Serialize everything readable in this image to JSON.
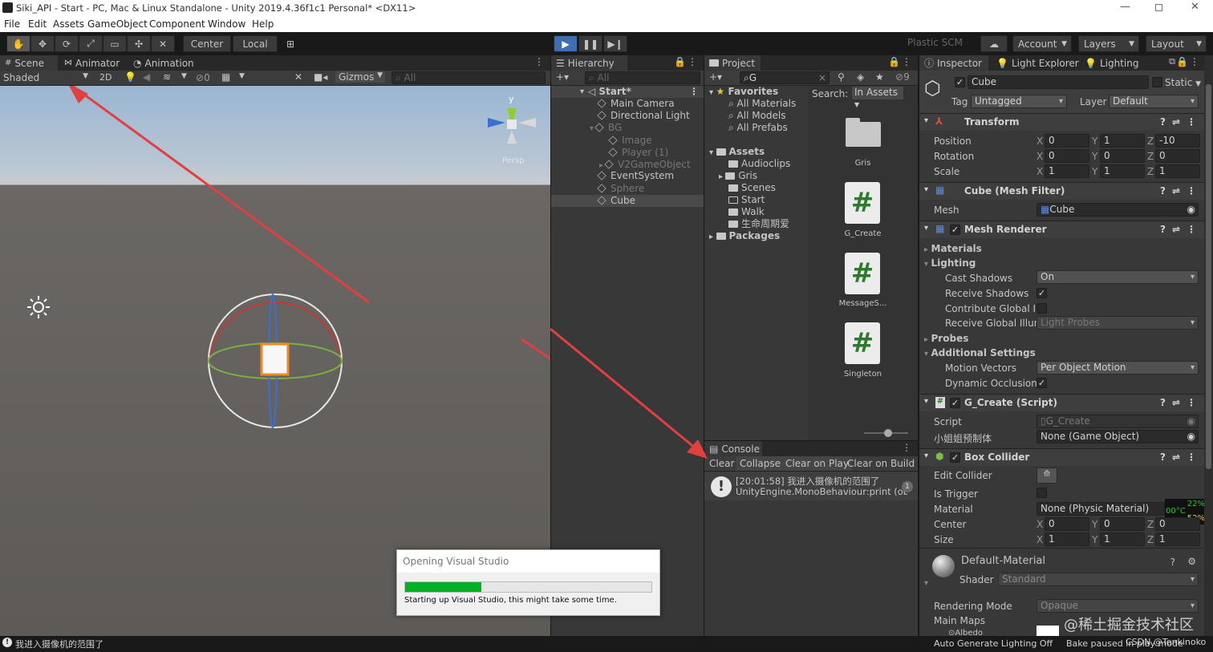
{
  "window": {
    "title": "Siki_API - Start - PC, Mac & Linux Standalone - Unity 2019.4.36f1c1 Personal* <DX11>"
  },
  "menu": [
    "File",
    "Edit",
    "Assets",
    "GameObject",
    "Component",
    "Window",
    "Help"
  ],
  "toolbar": {
    "center": "Center",
    "local": "Local",
    "plastic": "Plastic SCM",
    "account": "Account",
    "layers": "Layers",
    "layout": "Layout"
  },
  "scene": {
    "tabs": [
      "Scene",
      "Animator",
      "Animation"
    ],
    "shading": "Shaded",
    "mode2d": "2D",
    "fx_count": "0",
    "gizmos": "Gizmos",
    "search_placeholder": "All",
    "persp": "Persp",
    "axis_y": "y"
  },
  "hierarchy": {
    "title": "Hierarchy",
    "search_placeholder": "All",
    "scene_name": "Start*",
    "items": [
      {
        "label": "Main Camera",
        "dim": false
      },
      {
        "label": "Directional Light",
        "dim": false
      },
      {
        "label": "BG",
        "dim": true
      },
      {
        "label": "Image",
        "dim": true
      },
      {
        "label": "Player (1)",
        "dim": true
      },
      {
        "label": "V2GameObject",
        "dim": true
      },
      {
        "label": "EventSystem",
        "dim": false
      },
      {
        "label": "Sphere",
        "dim": true
      },
      {
        "label": "Cube",
        "dim": false
      }
    ]
  },
  "project": {
    "title": "Project",
    "search_value": "G",
    "hidden_count": "9",
    "search_label": "Search:",
    "search_scope": "In Assets",
    "favorites": "Favorites",
    "fav_items": [
      "All Materials",
      "All Models",
      "All Prefabs"
    ],
    "assets": "Assets",
    "asset_items": [
      "Audioclips",
      "Gris",
      "Scenes",
      "Start",
      "Walk",
      "生命周期爱"
    ],
    "packages": "Packages",
    "grid_items": [
      "Gris",
      "G_Create",
      "MessageS...",
      "Singleton"
    ]
  },
  "console": {
    "title": "Console",
    "buttons": [
      "Clear",
      "Collapse",
      "Clear on Play",
      "Clear on Build"
    ],
    "line1": "[20:01:58] 我进入摄像机的范围了",
    "line2": "UnityEngine.MonoBehaviour:print (object)",
    "count": "1"
  },
  "inspector": {
    "tabs": [
      "Inspector",
      "Light Explorer",
      "Lighting"
    ],
    "object_name": "Cube",
    "static_label": "Static",
    "tag_label": "Tag",
    "tag_value": "Untagged",
    "layer_label": "Layer",
    "layer_value": "Default",
    "transform": {
      "title": "Transform",
      "rows": [
        {
          "label": "Position",
          "x": "0",
          "y": "1",
          "z": "-10"
        },
        {
          "label": "Rotation",
          "x": "0",
          "y": "0",
          "z": "0"
        },
        {
          "label": "Scale",
          "x": "1",
          "y": "1",
          "z": "1"
        }
      ]
    },
    "mesh_filter": {
      "title": "Cube (Mesh Filter)",
      "mesh_label": "Mesh",
      "mesh_value": "Cube"
    },
    "mesh_renderer": {
      "title": "Mesh Renderer",
      "materials": "Materials",
      "lighting": "Lighting",
      "cast_shadows": "Cast Shadows",
      "cast_value": "On",
      "receive_shadows": "Receive Shadows",
      "contribute_gi": "Contribute Global Illu",
      "receive_gi": "Receive Global Illumi",
      "receive_gi_value": "Light Probes",
      "probes": "Probes",
      "additional": "Additional Settings",
      "motion_vectors": "Motion Vectors",
      "motion_value": "Per Object Motion",
      "dynamic_occlusion": "Dynamic Occlusion"
    },
    "script": {
      "title": "G_Create (Script)",
      "script_label": "Script",
      "script_value": "G_Create",
      "field_label": "小姐姐预制体",
      "field_value": "None (Game Object)"
    },
    "box_collider": {
      "title": "Box Collider",
      "edit": "Edit Collider",
      "trigger": "Is Trigger",
      "material": "Material",
      "material_value": "None (Physic Material)",
      "center": {
        "label": "Center",
        "x": "0",
        "y": "0",
        "z": "0"
      },
      "size": {
        "label": "Size",
        "x": "1",
        "y": "1",
        "z": "1"
      }
    },
    "material": {
      "name": "Default-Material",
      "shader_label": "Shader",
      "shader_value": "Standard",
      "rendering_mode": "Rendering Mode",
      "rendering_value": "Opaque",
      "main_maps": "Main Maps",
      "albedo": "Albedo"
    },
    "perf": {
      "p1": "22%",
      "temp": "00°C",
      "p2": "52%"
    }
  },
  "dialog": {
    "title": "Opening Visual Studio",
    "message": "Starting up Visual Studio, this might take some time.",
    "progress": 0.31
  },
  "status": {
    "message": "我进入摄像机的范围了",
    "lighting": "Auto Generate Lighting Off",
    "bake": "Bake paused in play mode",
    "watermark1": "@稀土掘金技术社区",
    "watermark2": "CSDN @Tenkinoko"
  }
}
